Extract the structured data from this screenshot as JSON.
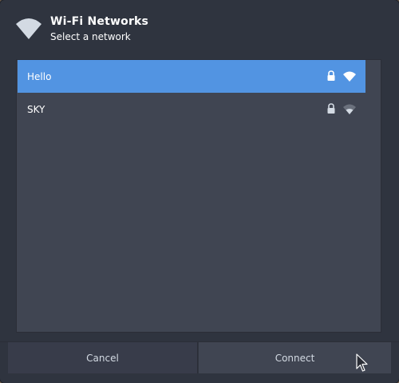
{
  "dialog": {
    "title": "Wi-Fi Networks",
    "subtitle": "Select a network",
    "header_icon": "wifi-icon"
  },
  "networks": [
    {
      "name": "Hello",
      "selected": true,
      "secured": true,
      "signal_icon": "wifi-signal-full-icon",
      "lock_icon": "lock-icon"
    },
    {
      "name": "SKY",
      "selected": false,
      "secured": true,
      "signal_icon": "wifi-signal-partial-icon",
      "lock_icon": "lock-icon"
    }
  ],
  "buttons": {
    "cancel_label": "Cancel",
    "connect_label": "Connect"
  },
  "colors": {
    "dialog_bg": "#2f343f",
    "list_bg": "#404552",
    "selection": "#5294e2",
    "text": "#ffffff"
  }
}
